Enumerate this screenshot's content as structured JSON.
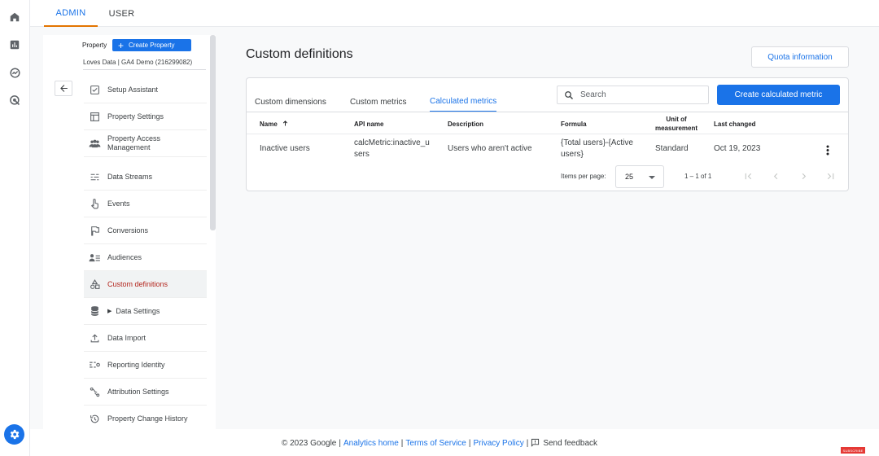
{
  "rail": {
    "icons": [
      "home-icon",
      "bar-chart-icon",
      "explore-icon",
      "advertising-icon",
      "gear-icon"
    ]
  },
  "top_tabs": [
    {
      "label": "ADMIN",
      "active": true
    },
    {
      "label": "USER",
      "active": false
    }
  ],
  "property": {
    "label": "Property",
    "create_label": "Create Property",
    "name": "Loves Data | GA4 Demo (216299082)"
  },
  "nav": {
    "items": [
      {
        "label": "Setup Assistant",
        "icon": "checkbox-icon"
      },
      {
        "label": "Property Settings",
        "icon": "layout-icon"
      },
      {
        "label": "Property Access Management",
        "icon": "people-icon"
      },
      {
        "label": "Data Streams",
        "icon": "streams-icon"
      },
      {
        "label": "Events",
        "icon": "touch-icon"
      },
      {
        "label": "Conversions",
        "icon": "flag-icon"
      },
      {
        "label": "Audiences",
        "icon": "audience-icon"
      },
      {
        "label": "Custom definitions",
        "icon": "shapes-icon",
        "active": true
      },
      {
        "label": "Data Settings",
        "icon": "database-icon",
        "expandable": true
      },
      {
        "label": "Data Import",
        "icon": "upload-icon"
      },
      {
        "label": "Reporting Identity",
        "icon": "identity-icon"
      },
      {
        "label": "Attribution Settings",
        "icon": "attribution-icon"
      },
      {
        "label": "Property Change History",
        "icon": "history-icon"
      }
    ]
  },
  "main": {
    "title": "Custom definitions",
    "quota_label": "Quota information",
    "tabs": [
      {
        "label": "Custom dimensions",
        "active": false
      },
      {
        "label": "Custom metrics",
        "active": false
      },
      {
        "label": "Calculated metrics",
        "active": true
      }
    ],
    "search_placeholder": "Search",
    "create_label": "Create calculated metric",
    "table": {
      "headers": {
        "name": "Name",
        "api": "API name",
        "description": "Description",
        "formula": "Formula",
        "unit": "Unit of measurement",
        "changed": "Last changed"
      },
      "sort": "ascending",
      "rows": [
        {
          "name": "Inactive users",
          "api": "calcMetric:inactive_users",
          "description": "Users who aren't active",
          "formula": "{Total users}-{Active users}",
          "unit": "Standard",
          "changed": "Oct 19, 2023"
        }
      ]
    },
    "pagination": {
      "items_per_page_label": "Items per page:",
      "items_per_page": "25",
      "range": "1 – 1 of 1"
    }
  },
  "footer": {
    "copyright": "© 2023 Google",
    "analytics_home": "Analytics home",
    "terms": "Terms of Service",
    "privacy": "Privacy Policy",
    "feedback": "Send feedback",
    "separator": "|"
  },
  "overlay": {
    "subscribe": "SUBSCRIBE"
  },
  "colors": {
    "accent": "#1a73e8",
    "active_nav_text": "#b3261e",
    "admin_tab_underline": "#e37400"
  }
}
